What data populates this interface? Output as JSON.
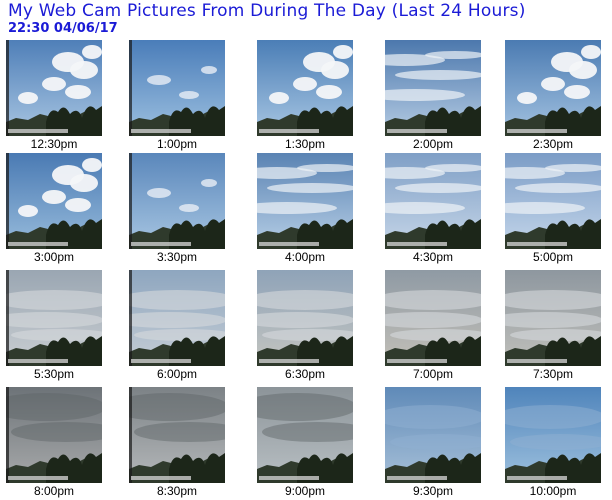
{
  "header": {
    "title": "My Web Cam Pictures From During The Day (Last 24 Hours)",
    "timestamp": "22:30  04/06/17"
  },
  "thumbnails": [
    {
      "time": "12:30pm",
      "sky": "#4f7fb8",
      "horizon": "#a9c6e2",
      "clouds": "puffy"
    },
    {
      "time": "1:00pm",
      "sky": "#4a7db9",
      "horizon": "#9dc0e0",
      "clouds": "light"
    },
    {
      "time": "1:30pm",
      "sky": "#4b7eb6",
      "horizon": "#a9c7e3",
      "clouds": "puffy"
    },
    {
      "time": "2:00pm",
      "sky": "#4c78ad",
      "horizon": "#b7cde4",
      "clouds": "streaks"
    },
    {
      "time": "2:30pm",
      "sky": "#4b7bb2",
      "horizon": "#a4c3e1",
      "clouds": "puffy"
    },
    {
      "time": "3:00pm",
      "sky": "#4a7ab3",
      "horizon": "#98bcdc",
      "clouds": "puffy"
    },
    {
      "time": "3:30pm",
      "sky": "#5a87bb",
      "horizon": "#a8c6e2",
      "clouds": "light"
    },
    {
      "time": "4:00pm",
      "sky": "#5a83b3",
      "horizon": "#b7cfe6",
      "clouds": "streaks"
    },
    {
      "time": "4:30pm",
      "sky": "#7f9fc6",
      "horizon": "#c6d6e8",
      "clouds": "streaks"
    },
    {
      "time": "5:00pm",
      "sky": "#7b9cc6",
      "horizon": "#c4d6ea",
      "clouds": "streaks"
    },
    {
      "time": "5:30pm",
      "sky": "#9aa6b2",
      "horizon": "#c9ced2",
      "clouds": "overcast"
    },
    {
      "time": "6:00pm",
      "sky": "#8ea6bf",
      "horizon": "#c5cdd5",
      "clouds": "overcast"
    },
    {
      "time": "6:30pm",
      "sky": "#8fa3b8",
      "horizon": "#c4c5c0",
      "clouds": "overcast"
    },
    {
      "time": "7:00pm",
      "sky": "#8f9aa4",
      "horizon": "#c3c0b8",
      "clouds": "overcast"
    },
    {
      "time": "7:30pm",
      "sky": "#8e979f",
      "horizon": "#c0c0bb",
      "clouds": "overcast"
    },
    {
      "time": "8:00pm",
      "sky": "#6d7378",
      "horizon": "#a8aaab",
      "clouds": "dark"
    },
    {
      "time": "8:30pm",
      "sky": "#7c8286",
      "horizon": "#b5b8ba",
      "clouds": "dark"
    },
    {
      "time": "9:00pm",
      "sky": "#8c9499",
      "horizon": "#b9c0c4",
      "clouds": "dark"
    },
    {
      "time": "9:30pm",
      "sky": "#5f8ab8",
      "horizon": "#a7c0d8",
      "clouds": "dusk"
    },
    {
      "time": "10:00pm",
      "sky": "#4f84bb",
      "horizon": "#9ec1de",
      "clouds": "dusk"
    }
  ]
}
